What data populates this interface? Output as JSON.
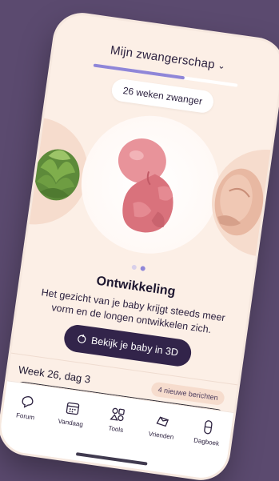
{
  "header": {
    "title": "Mijn zwangerschap"
  },
  "progress": {
    "fraction": 0.63
  },
  "pregnancy": {
    "weeks_label": "26 weken zwanger"
  },
  "carousel": {
    "left_item": "artichoke",
    "center_item": "fetus",
    "right_item": "pregnant-belly",
    "active_index": 1,
    "count": 2
  },
  "section": {
    "title": "Ontwikkeling",
    "description": "Het gezicht van je baby krijgt steeds meer vorm en de longen ontwikkelen zich.",
    "cta": "Bekijk je baby in 3D"
  },
  "day": {
    "label": "Week 26, dag 3",
    "badge": "4 nieuwe berichten"
  },
  "tabs": [
    {
      "label": "Forum",
      "icon": "forum-icon"
    },
    {
      "label": "Vandaag",
      "icon": "calendar-icon"
    },
    {
      "label": "Tools",
      "icon": "tools-icon"
    },
    {
      "label": "Vrienden",
      "icon": "friends-icon"
    },
    {
      "label": "Dagboek",
      "icon": "diary-icon"
    }
  ],
  "colors": {
    "background": "#5b4a6f",
    "accent": "#8f86d8",
    "button": "#32244a"
  }
}
